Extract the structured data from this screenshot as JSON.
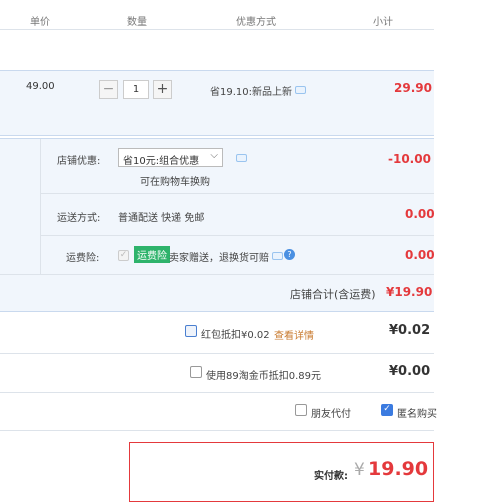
{
  "header": {
    "unit_price": "单价",
    "quantity": "数量",
    "discount": "优惠方式",
    "subtotal": "小计"
  },
  "item": {
    "price": "49.00",
    "quantity": "1",
    "promo": "省19.10:新品上新",
    "subtotal": "29.90"
  },
  "shop": {
    "discount_label": "店铺优惠:",
    "discount_select": "省10元:组合优惠",
    "discount_sub": "可在购物车换购",
    "discount_amount": "-10.00",
    "shipping_label": "运送方式:",
    "shipping_value": "普通配送 快递 免邮",
    "shipping_amount": "0.00",
    "insurance_label": "运费险:",
    "insurance_badge": "运费险",
    "insurance_text": "卖家赠送，退换货可赔",
    "insurance_amount": "0.00",
    "total_label": "店铺合计(含运费)",
    "total_amount": "¥19.90"
  },
  "redpacket": {
    "label": "红包抵扣¥0.02",
    "link": "查看详情",
    "amount": "¥0.02"
  },
  "taojinbi": {
    "label": "使用89淘金币抵扣0.89元",
    "amount": "¥0.00"
  },
  "options": {
    "friend_pay": "朋友代付",
    "anonymous": "匿名购买"
  },
  "payment": {
    "label": "实付款:",
    "currency": "¥",
    "amount": "19.90"
  },
  "colors": {
    "accent_red": "#e4393c",
    "checkbox_blue": "#3b7be0",
    "panel_blue": "#f1f6fc",
    "badge_green": "#2eb36b"
  }
}
